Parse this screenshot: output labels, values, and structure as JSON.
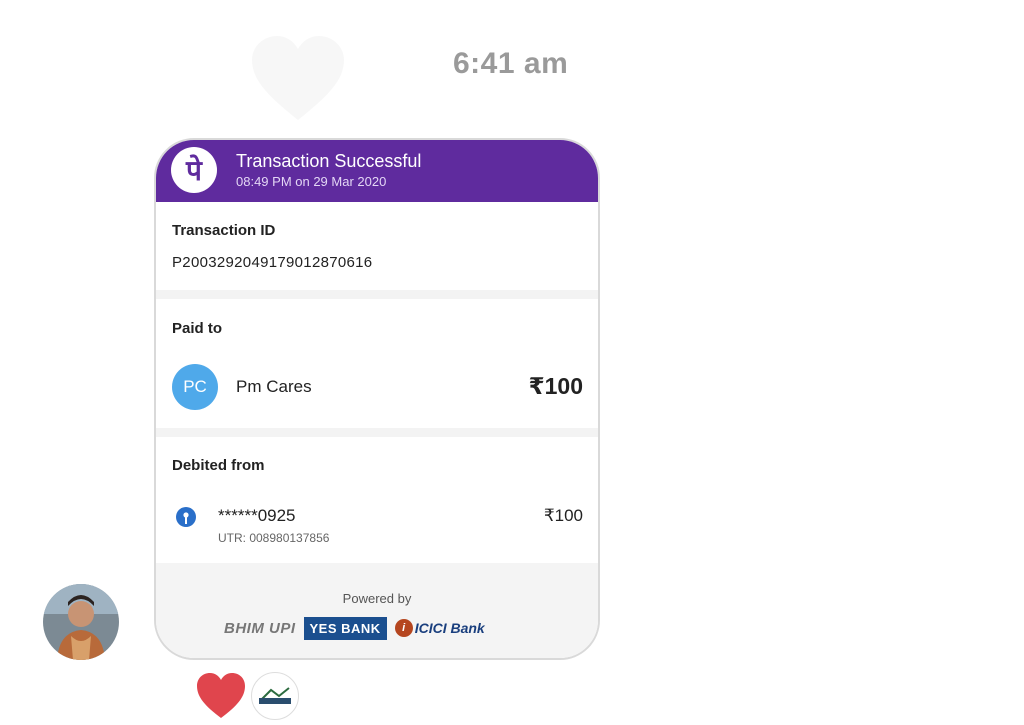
{
  "chat": {
    "timestamp": "6:41 am"
  },
  "card": {
    "header": {
      "logo_glyph": "पे",
      "title": "Transaction Successful",
      "subtitle": "08:49 PM on 29 Mar 2020"
    },
    "transaction": {
      "label": "Transaction ID",
      "id": "P2003292049179012870616"
    },
    "paid_to": {
      "label": "Paid to",
      "initials": "PC",
      "name": "Pm Cares",
      "amount": "₹100"
    },
    "debited_from": {
      "label": "Debited from",
      "account": "******0925",
      "utr": "UTR: 008980137856",
      "amount": "₹100"
    },
    "footer": {
      "powered_by": "Powered by",
      "logos": {
        "bhim_upi": "BHIM UPI",
        "yes_bank": "YES BANK",
        "icici_bank": "ICICI Bank"
      }
    }
  },
  "colors": {
    "header_purple": "#5f2b9e",
    "payee_avatar_blue": "#4fa9ea",
    "reaction_heart_red": "#e0454d",
    "timestamp_gray": "#9a9a9a"
  },
  "icons": {
    "ghost_heart": "heart-icon",
    "bank": "sbi-bank-icon",
    "reaction": "heart-icon"
  }
}
